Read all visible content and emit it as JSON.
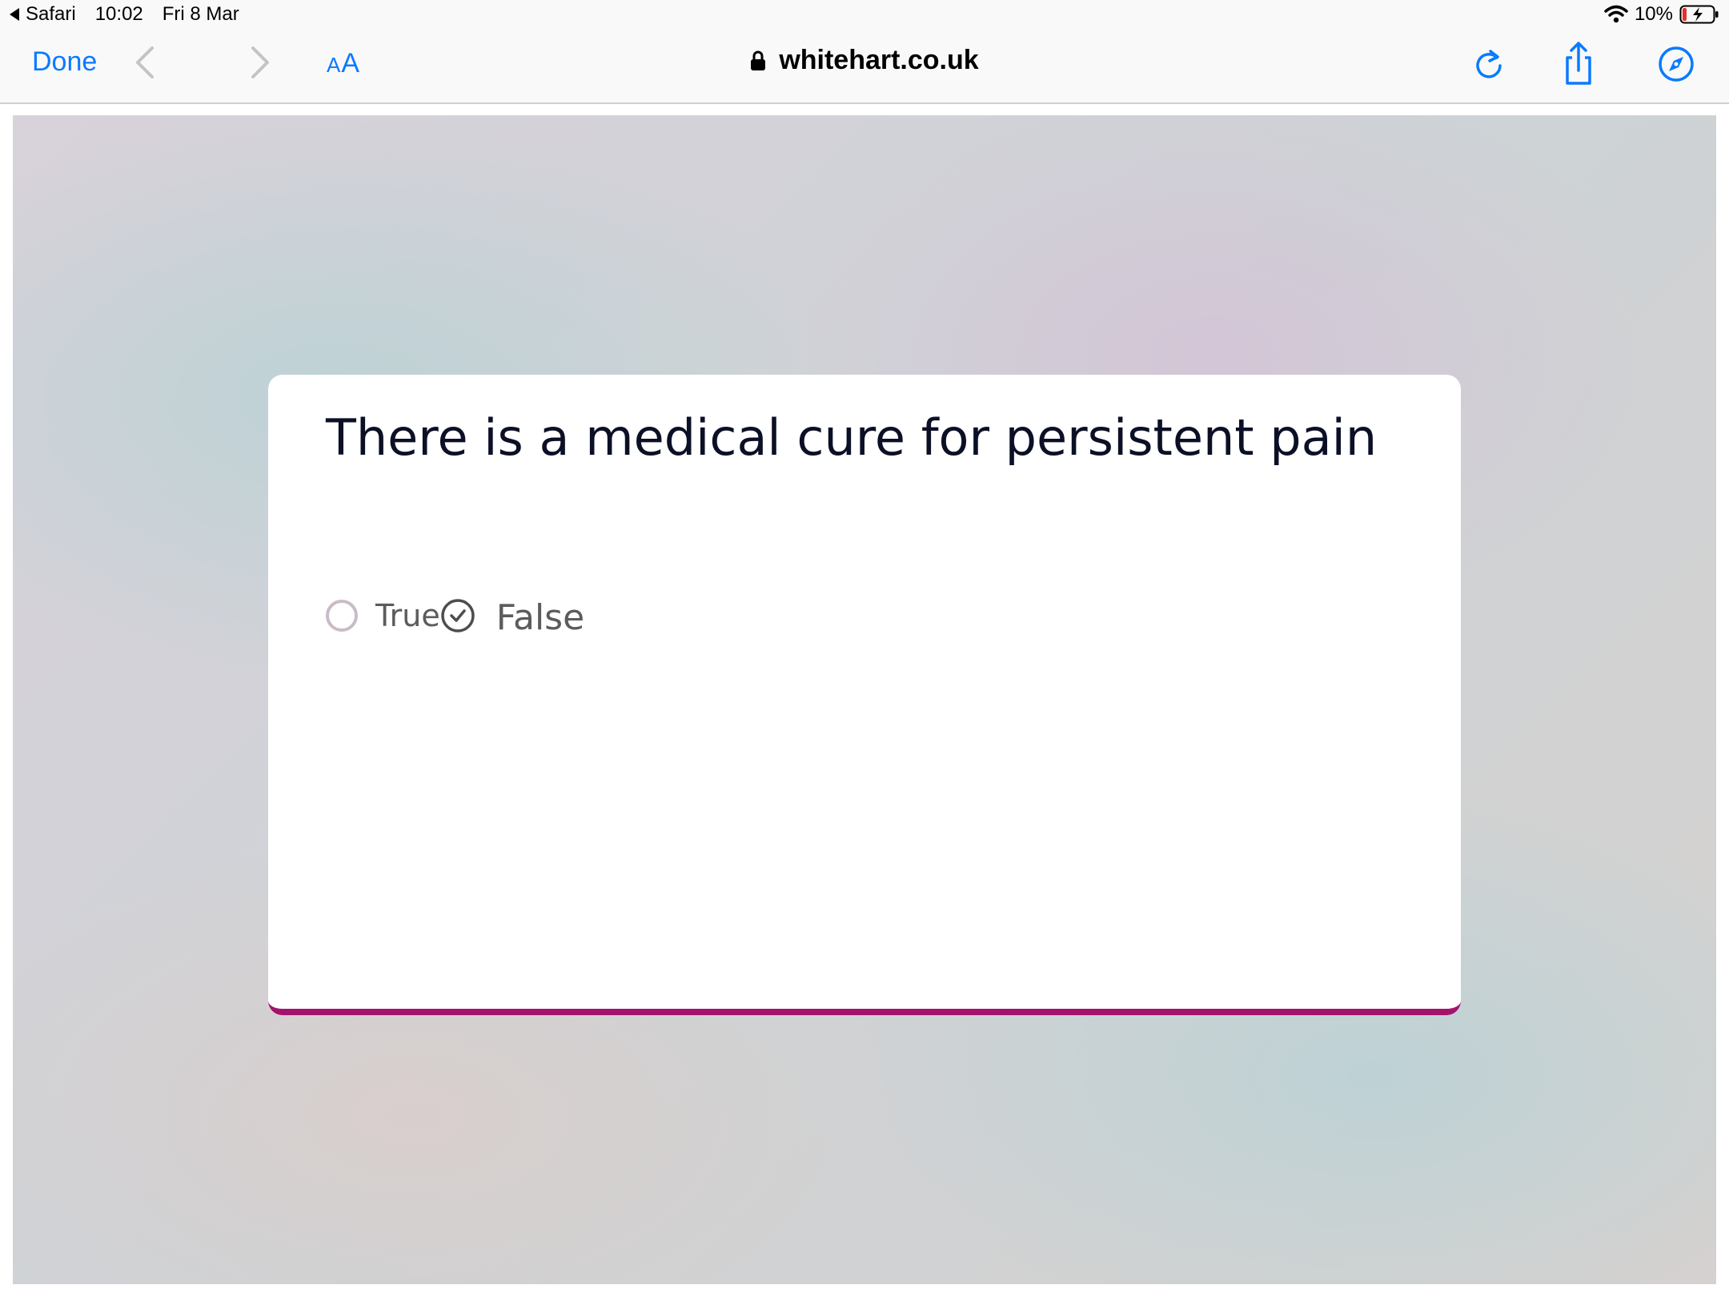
{
  "status_bar": {
    "back_app": "Safari",
    "time": "10:02",
    "date": "Fri 8 Mar",
    "battery": "10%"
  },
  "toolbar": {
    "done_label": "Done",
    "text_size_small": "A",
    "text_size_large": "A",
    "address": "whitehart.co.uk"
  },
  "icons": {
    "back": "chevron-left-icon",
    "forward": "chevron-right-icon",
    "lock": "lock-icon",
    "reload": "reload-icon",
    "share": "share-icon",
    "compass": "compass-icon",
    "wifi": "wifi-icon",
    "battery": "battery-charging-icon"
  },
  "colors": {
    "accent": "#0a7aff",
    "card_border": "#a3136e",
    "question_text": "#0b1026",
    "option_text": "#5c5c5c",
    "battery_low": "#e0322f"
  },
  "question": {
    "text": "There is a medical cure for persistent pain",
    "options": [
      {
        "label": "True",
        "selected": false
      },
      {
        "label": "False",
        "selected": true
      }
    ]
  }
}
